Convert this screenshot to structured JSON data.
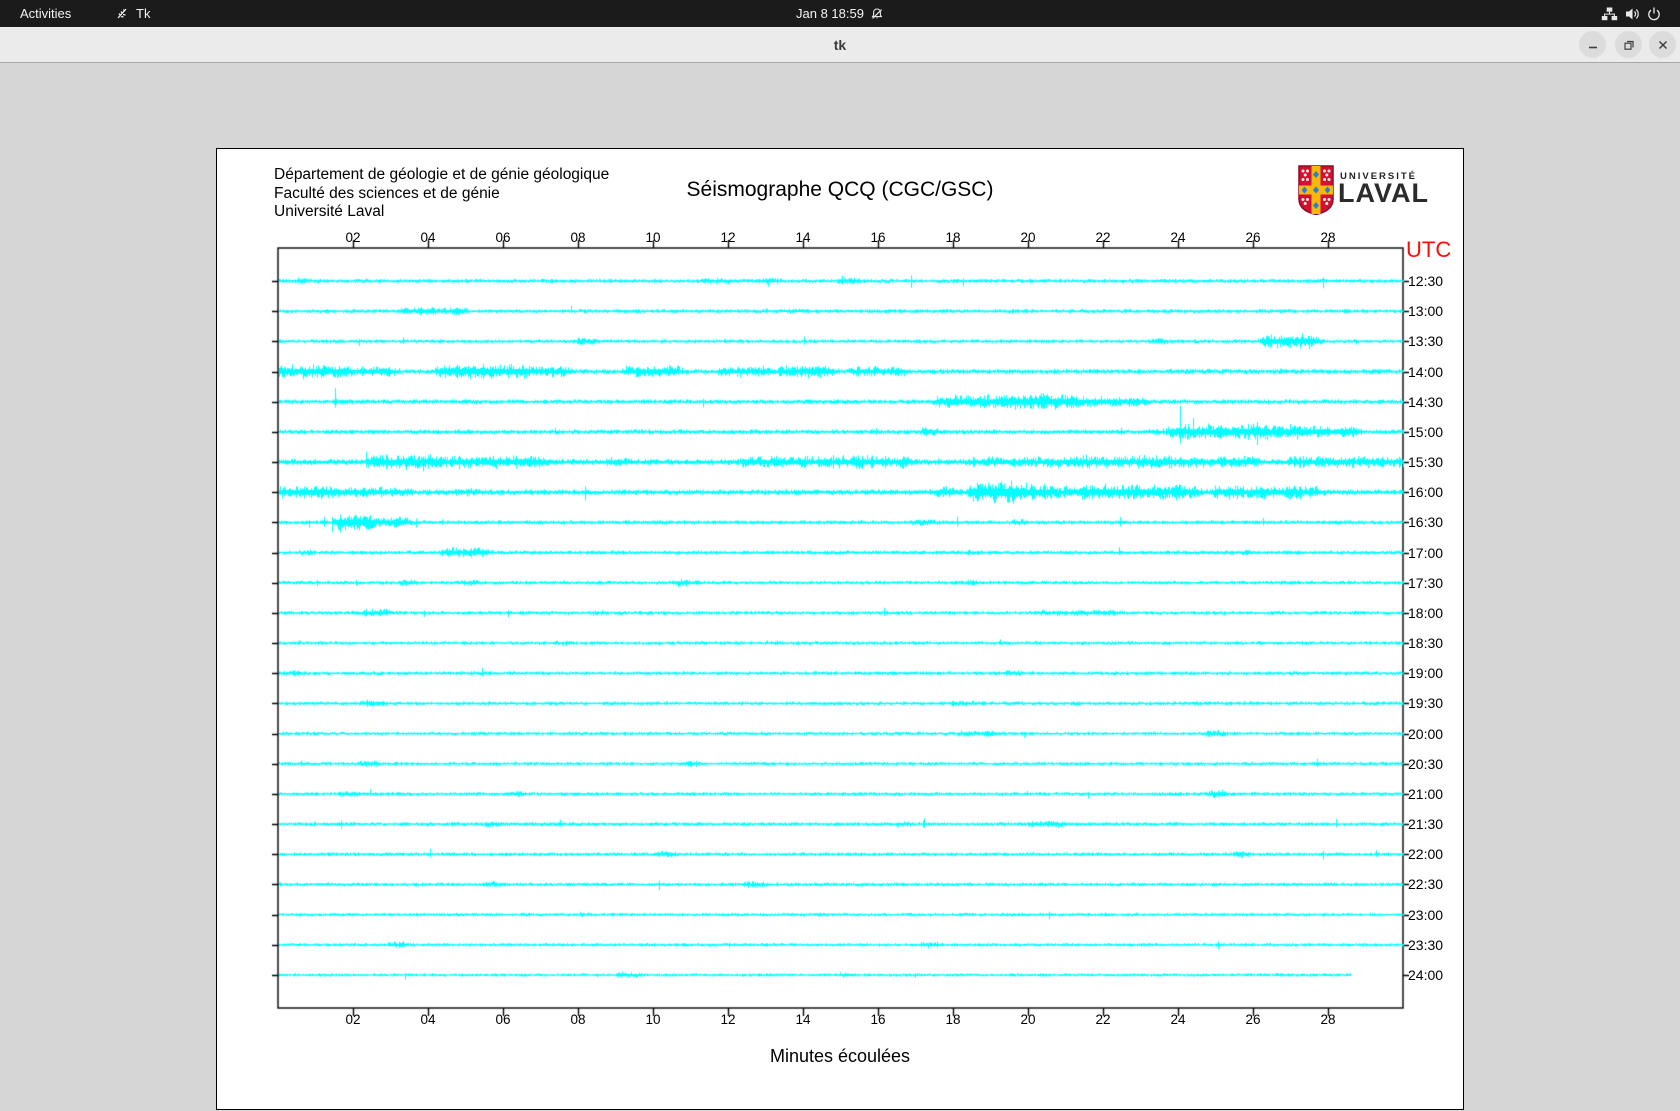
{
  "topbar": {
    "activities_label": "Activities",
    "app_name": "Tk",
    "clock": "Jan 8  18:59"
  },
  "titlebar": {
    "title": "tk"
  },
  "seismograph": {
    "header_lines": [
      "Département de géologie et de génie géologique",
      "Faculté des sciences et de génie",
      "Université Laval"
    ],
    "title": "Séismographe QCQ (CGC/GSC)",
    "utc_label": "UTC",
    "xlabel": "Minutes écoulées",
    "logo": {
      "line1": "UNIVERSITÉ",
      "line2": "LAVAL"
    },
    "colors": {
      "trace": "#00ffff",
      "utc_label": "#fb0d07",
      "axis": "#000000",
      "logo_red": "#d21034",
      "logo_gold": "#f5b80c",
      "logo_blue": "#2a7fd4"
    },
    "chart_data": {
      "type": "seismogram",
      "x_ticks": [
        "02",
        "04",
        "06",
        "08",
        "10",
        "12",
        "14",
        "16",
        "18",
        "20",
        "22",
        "24",
        "26",
        "28"
      ],
      "x_range_minutes": [
        0,
        30
      ],
      "rows": [
        {
          "time": "12:30",
          "base": 2.1,
          "bursts": [
            [
              0.5,
              0.7,
              3.5
            ],
            [
              11.3,
              12.0,
              4
            ],
            [
              12.8,
              13.3,
              3.5
            ],
            [
              15.0,
              15.4,
              4
            ]
          ]
        },
        {
          "time": "13:00",
          "base": 2.1,
          "bursts": [
            [
              3.3,
              4.2,
              5
            ],
            [
              4.4,
              4.9,
              4.5
            ],
            [
              13.6,
              14.0,
              3.5
            ]
          ]
        },
        {
          "time": "13:30",
          "base": 2.0,
          "bursts": [
            [
              8.0,
              8.3,
              4.5
            ],
            [
              23.3,
              23.6,
              4
            ],
            [
              26.3,
              27.5,
              8.5
            ]
          ]
        },
        {
          "time": "14:00",
          "base": 2.6,
          "bursts": [
            [
              0,
              1.8,
              8
            ],
            [
              2.2,
              3.0,
              6
            ],
            [
              4.3,
              6.6,
              8.5
            ],
            [
              6.8,
              7.6,
              7
            ],
            [
              9.3,
              10.6,
              7.5
            ],
            [
              11.8,
              13.0,
              6.5
            ],
            [
              13.4,
              14.6,
              7.5
            ],
            [
              15.3,
              16.6,
              6
            ]
          ]
        },
        {
          "time": "14:30",
          "base": 2.4,
          "bursts": [
            [
              1.5,
              1.8,
              4.5
            ],
            [
              17.6,
              19.4,
              8
            ],
            [
              19.5,
              21.2,
              9.5
            ],
            [
              21.4,
              23.0,
              6
            ]
          ]
        },
        {
          "time": "15:00",
          "base": 2.4,
          "bursts": [
            [
              17.2,
              17.5,
              5.5
            ],
            [
              23.3,
              23.6,
              4
            ],
            [
              23.8,
              27.2,
              9
            ],
            [
              27.3,
              28.6,
              7
            ]
          ]
        },
        {
          "time": "15:30",
          "base": 3.2,
          "bursts": [
            [
              2.4,
              4.4,
              8
            ],
            [
              4.6,
              7.0,
              7.5
            ],
            [
              8.8,
              9.3,
              6
            ],
            [
              12.4,
              14.2,
              7
            ],
            [
              14.4,
              16.8,
              7.5
            ],
            [
              18.4,
              20.8,
              6.5
            ],
            [
              21.0,
              24.2,
              7.5
            ],
            [
              24.4,
              26.0,
              6.5
            ],
            [
              27.0,
              29.9,
              6.5
            ]
          ]
        },
        {
          "time": "16:00",
          "base": 2.8,
          "bursts": [
            [
              0,
              1.6,
              7.5
            ],
            [
              1.8,
              3.4,
              6.5
            ],
            [
              4.8,
              5.2,
              5
            ],
            [
              17.6,
              18.0,
              6.5
            ],
            [
              18.5,
              19.6,
              13
            ],
            [
              19.7,
              20.6,
              10
            ],
            [
              21.0,
              24.4,
              8.5
            ],
            [
              25.0,
              27.6,
              8
            ]
          ]
        },
        {
          "time": "16:30",
          "base": 2.1,
          "bursts": [
            [
              1.6,
              2.4,
              10.5
            ],
            [
              2.5,
              3.3,
              7
            ],
            [
              17.0,
              17.4,
              4.5
            ],
            [
              19.6,
              19.9,
              4
            ]
          ]
        },
        {
          "time": "17:00",
          "base": 2.1,
          "bursts": [
            [
              0.6,
              0.9,
              3.5
            ],
            [
              4.4,
              5.4,
              6.5
            ],
            [
              8.9,
              9.2,
              3.5
            ],
            [
              18.4,
              18.7,
              3.5
            ],
            [
              25.7,
              26.0,
              3.5
            ]
          ]
        },
        {
          "time": "17:30",
          "base": 2.0,
          "bursts": [
            [
              3.3,
              3.6,
              4
            ],
            [
              4.9,
              5.2,
              4
            ],
            [
              10.6,
              11.0,
              4.5
            ],
            [
              18.4,
              18.7,
              3.5
            ]
          ]
        },
        {
          "time": "18:00",
          "base": 2.0,
          "bursts": [
            [
              2.3,
              2.8,
              5
            ],
            [
              8.4,
              8.7,
              3
            ],
            [
              20.4,
              21.0,
              4
            ],
            [
              21.2,
              22.3,
              3.8
            ]
          ]
        },
        {
          "time": "18:30",
          "base": 1.9,
          "bursts": [
            [
              7.4,
              7.8,
              3.2
            ],
            [
              13.0,
              13.3,
              3
            ]
          ]
        },
        {
          "time": "19:00",
          "base": 2.0,
          "bursts": [
            [
              0.2,
              0.5,
              3.8
            ],
            [
              19.4,
              19.8,
              3.8
            ]
          ]
        },
        {
          "time": "19:30",
          "base": 2.0,
          "bursts": [
            [
              2.3,
              2.7,
              4.5
            ],
            [
              18.0,
              18.4,
              3.8
            ]
          ]
        },
        {
          "time": "20:00",
          "base": 1.9,
          "bursts": [
            [
              18.2,
              19.0,
              4.2
            ],
            [
              24.8,
              25.1,
              4.2
            ]
          ]
        },
        {
          "time": "20:30",
          "base": 1.9,
          "bursts": [
            [
              2.2,
              2.5,
              3.8
            ],
            [
              10.8,
              11.1,
              3.8
            ]
          ]
        },
        {
          "time": "21:00",
          "base": 1.9,
          "bursts": [
            [
              1.7,
              2.0,
              3.8
            ],
            [
              6.1,
              6.4,
              3.8
            ],
            [
              24.9,
              25.2,
              4.5
            ]
          ]
        },
        {
          "time": "21:30",
          "base": 2.0,
          "bursts": [
            [
              5.6,
              5.9,
              3.8
            ],
            [
              16.5,
              16.8,
              3.8
            ],
            [
              20.0,
              20.9,
              4
            ]
          ]
        },
        {
          "time": "22:00",
          "base": 1.9,
          "bursts": [
            [
              10.1,
              10.4,
              4.5
            ],
            [
              25.5,
              25.8,
              3.8
            ]
          ]
        },
        {
          "time": "22:30",
          "base": 1.9,
          "bursts": [
            [
              5.5,
              5.8,
              3.8
            ],
            [
              12.5,
              12.8,
              4.5
            ]
          ]
        },
        {
          "time": "23:00",
          "base": 1.8,
          "bursts": [
            [
              7.9,
              8.2,
              3.2
            ]
          ]
        },
        {
          "time": "23:30",
          "base": 1.8,
          "bursts": [
            [
              3.0,
              3.3,
              4.2
            ],
            [
              17.2,
              17.5,
              3.8
            ]
          ]
        },
        {
          "time": "24:00",
          "base": 1.7,
          "end_min": 28.6,
          "bursts": [
            [
              9.1,
              9.4,
              3.8
            ],
            [
              15.0,
              15.3,
              3.2
            ]
          ]
        }
      ]
    }
  }
}
